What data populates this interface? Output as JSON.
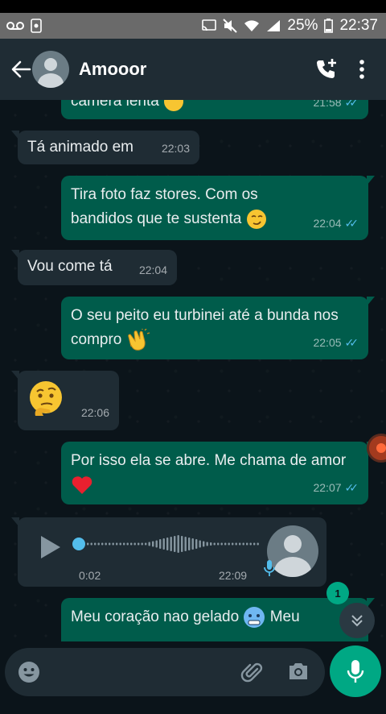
{
  "status_bar": {
    "battery": "25%",
    "time": "22:37",
    "icons": [
      "voicemail-icon",
      "android-icon",
      "cast-icon",
      "mute-icon",
      "wifi-icon",
      "signal-icon",
      "battery-icon"
    ]
  },
  "header": {
    "contact_name": "Amooor",
    "icons": [
      "back-arrow-icon",
      "avatar",
      "add-call-icon",
      "more-vert-icon"
    ]
  },
  "messages": [
    {
      "dir": "out",
      "text": "câmera lenta",
      "emoji": "thinking-face",
      "time": "21:58",
      "read": true
    },
    {
      "dir": "in",
      "text": "Tá animado em",
      "time": "22:03"
    },
    {
      "dir": "out",
      "text": "Tira foto faz stores. Com os bandidos que te sustenta",
      "emoji": "smirk",
      "time": "22:04",
      "read": true
    },
    {
      "dir": "in",
      "text": "Vou come tá",
      "time": "22:04"
    },
    {
      "dir": "out",
      "text": "O seu peito eu turbinei até a bunda nos compro",
      "emoji": "clapping-hands",
      "time": "22:05",
      "read": true
    },
    {
      "dir": "in",
      "text": "",
      "emoji": "thinking-face",
      "time": "22:06"
    },
    {
      "dir": "out",
      "text": "Por isso ela se abre. Me chama de amor",
      "emoji": "red-heart",
      "time": "22:07",
      "read": true
    },
    {
      "dir": "out",
      "text": "Meu coração nao gelado",
      "emoji": "cold-face",
      "text_after": "Meu",
      "partial": true
    }
  ],
  "voice_message": {
    "duration": "0:02",
    "time": "22:09",
    "progress": 0
  },
  "unread_count": "1",
  "composer": {
    "placeholder": "",
    "icons": [
      "emoji-icon",
      "attach-icon",
      "camera-icon",
      "mic-icon"
    ]
  },
  "colors": {
    "header_bg": "#1f2c34",
    "chat_bg": "#0b141a",
    "outgoing_bubble": "#005c4b",
    "incoming_bubble": "#1f2c34",
    "accent": "#00a884",
    "read_ticks": "#53bdeb"
  }
}
